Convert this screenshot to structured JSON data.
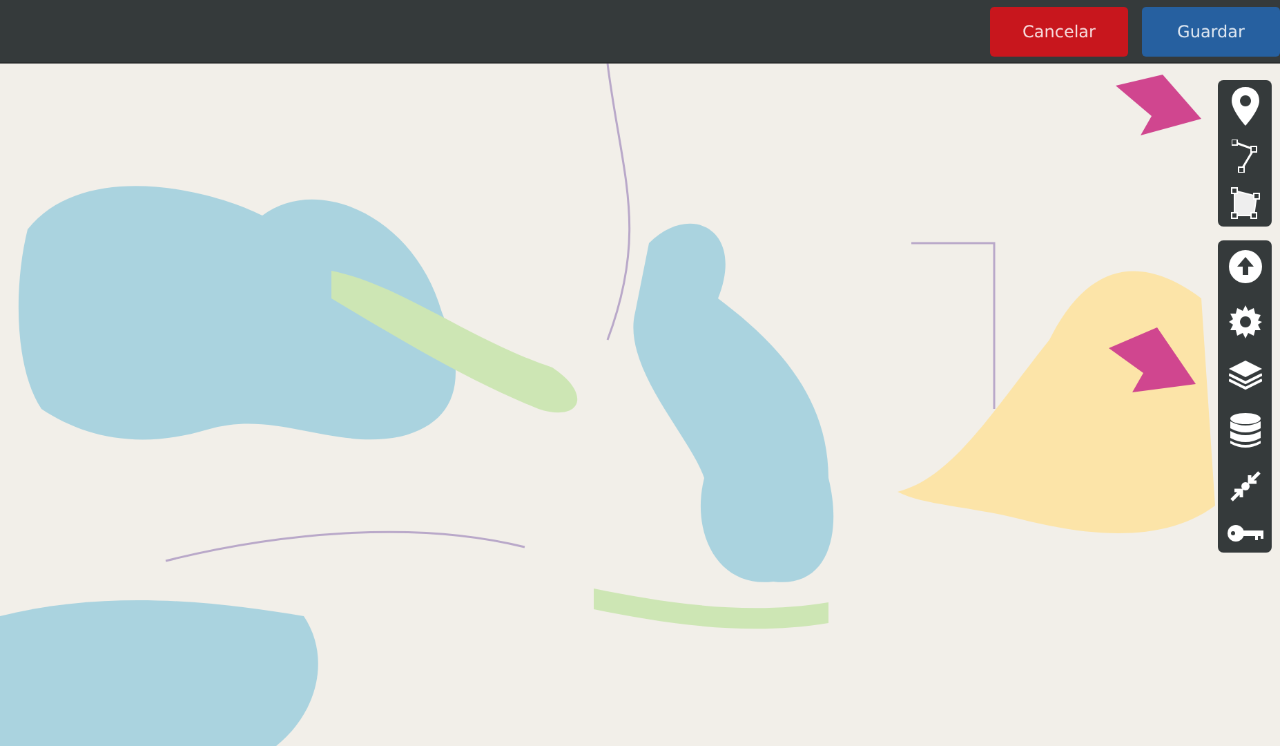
{
  "header": {
    "buttons": [
      {
        "label": "Cancelar",
        "kind": "cancel"
      },
      {
        "label": "Guardar",
        "kind": "save"
      }
    ]
  }
}
